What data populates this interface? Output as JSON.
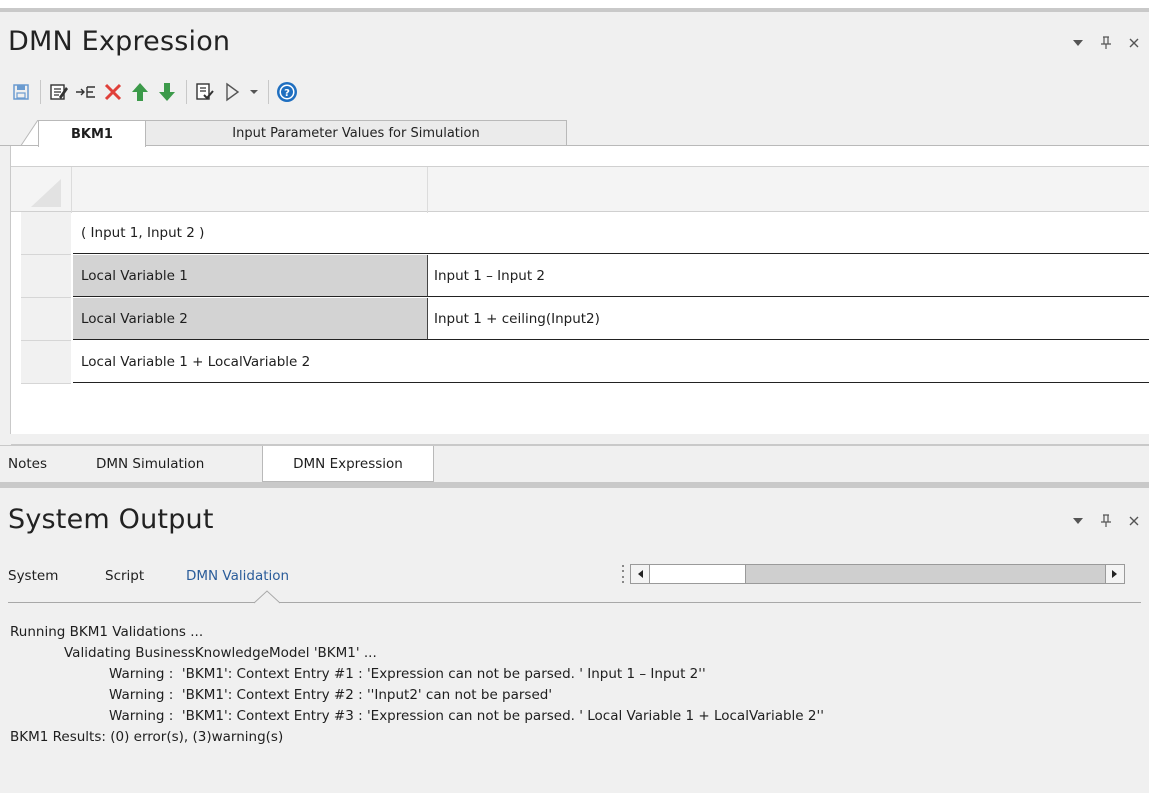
{
  "expression_panel": {
    "title": "DMN Expression",
    "toolbar": {
      "buttons": [
        "save-icon",
        "edit-icon",
        "insert-entry-icon",
        "delete-icon",
        "move-up-icon",
        "move-down-icon",
        "validate-icon",
        "run-icon",
        "dropdown-icon",
        "help-icon"
      ]
    },
    "tabs": [
      "BKM1",
      "Input Parameter Values for Simulation"
    ],
    "grid": {
      "parameters": "( Input 1, Input 2 )",
      "entries": [
        {
          "variable": "Local Variable 1",
          "expression": "Input 1 – Input 2"
        },
        {
          "variable": "Local Variable 2",
          "expression": "Input 1 + ceiling(Input2)"
        }
      ],
      "result": "Local Variable 1 + LocalVariable 2"
    },
    "bottom_tabs": [
      "Notes",
      "DMN Simulation",
      "DMN Expression"
    ]
  },
  "output_panel": {
    "title": "System Output",
    "tabs": [
      "System",
      "Script",
      "DMN Validation"
    ],
    "active_tab": "DMN Validation",
    "lines": [
      "Running BKM1 Validations ...",
      "Validating BusinessKnowledgeModel 'BKM1' ...",
      "Warning :  'BKM1': Context Entry #1 : 'Expression can not be parsed. ' Input 1 – Input 2''",
      "Warning :  'BKM1': Context Entry #2 : ''Input2' can not be parsed'",
      "Warning :  'BKM1': Context Entry #3 : 'Expression can not be parsed. ' Local Variable 1 + LocalVariable 2''",
      "BKM1 Results: (0) error(s), (3)warning(s)"
    ]
  },
  "colors": {
    "panel_bg": "#f0f0f0",
    "accent_link": "#2a5c9a",
    "delete_red": "#e0403a",
    "arrow_green": "#3c9a4a",
    "help_blue": "#1f6fc0"
  }
}
